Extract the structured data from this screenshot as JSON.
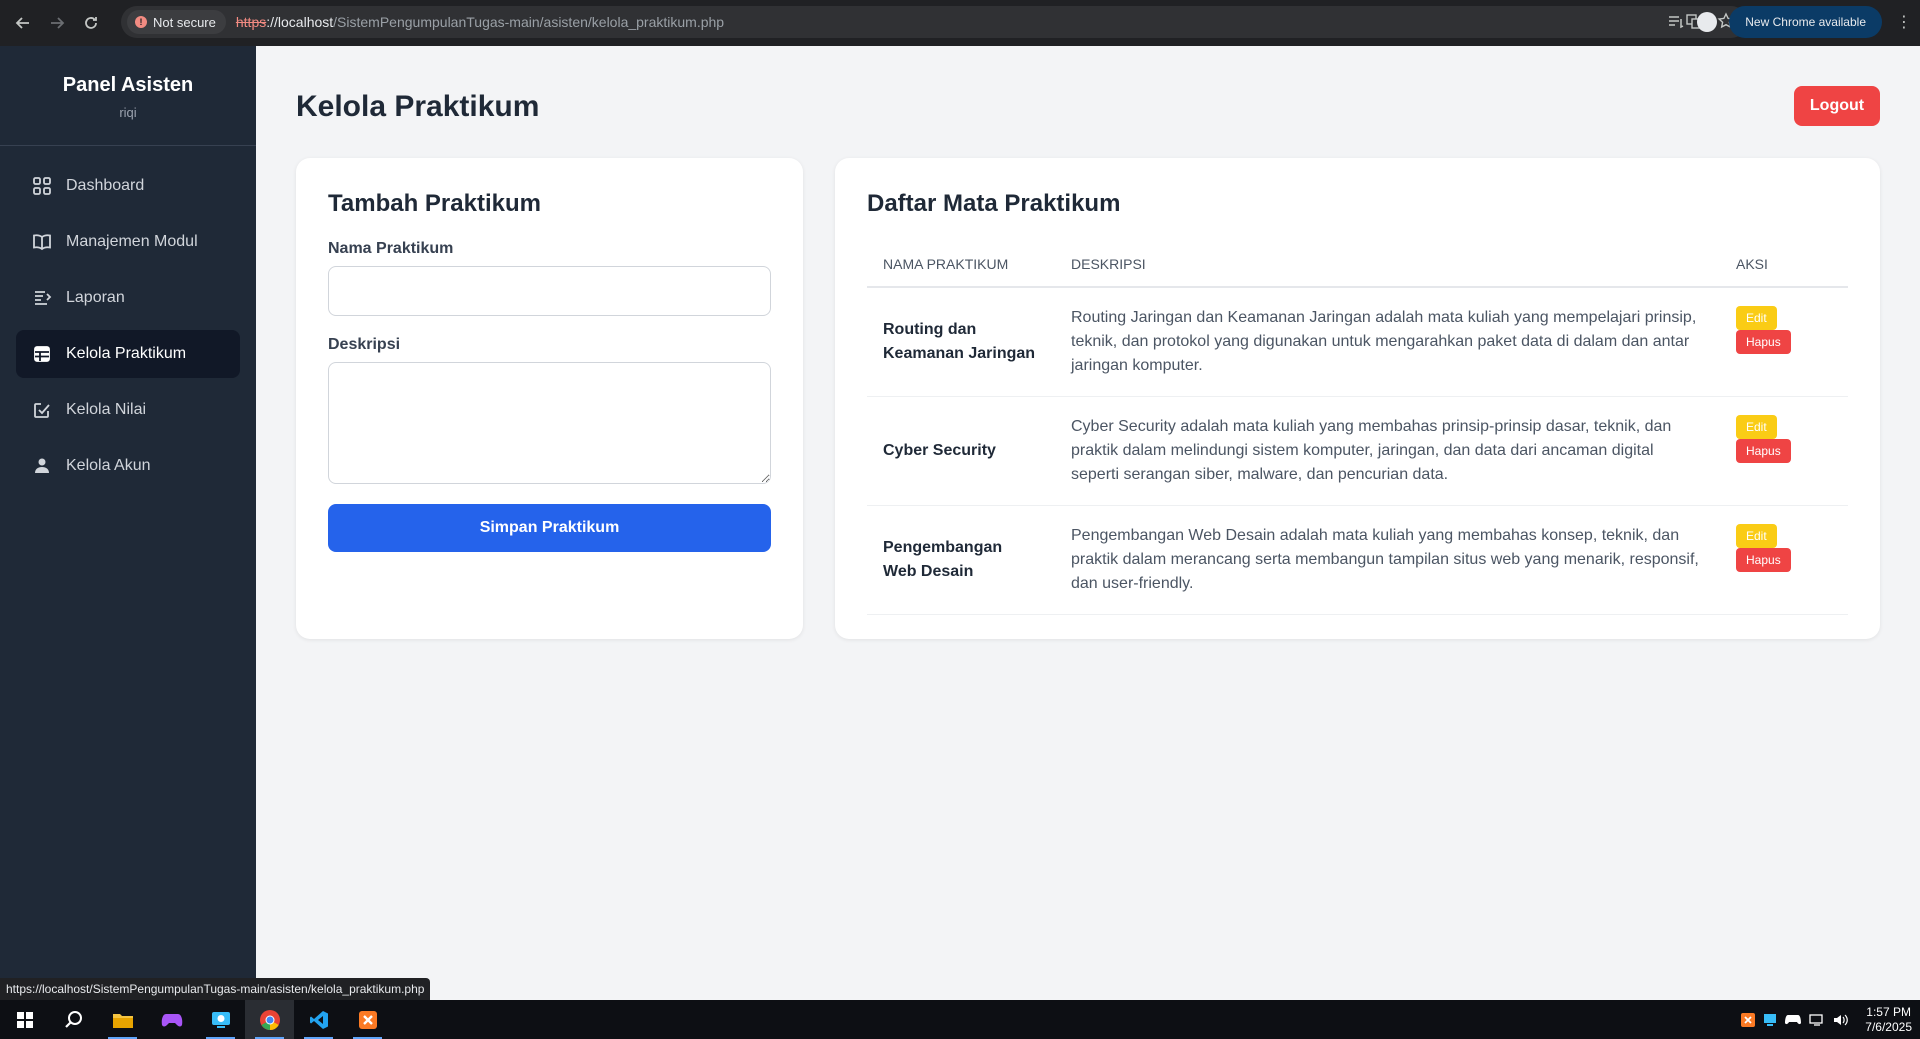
{
  "browser": {
    "security_label": "Not secure",
    "url_scheme": "https",
    "url_host": "://localhost",
    "url_path": "/SistemPengumpulanTugas-main/asisten/kelola_praktikum.php",
    "new_chrome_label": "New Chrome available",
    "status_url": "https://localhost/SistemPengumpulanTugas-main/asisten/kelola_praktikum.php"
  },
  "sidebar": {
    "title": "Panel Asisten",
    "user": "riqi",
    "items": [
      {
        "label": "Dashboard",
        "icon": "grid-icon"
      },
      {
        "label": "Manajemen Modul",
        "icon": "book-icon"
      },
      {
        "label": "Laporan",
        "icon": "list-icon"
      },
      {
        "label": "Kelola Praktikum",
        "icon": "table-icon",
        "active": true
      },
      {
        "label": "Kelola Nilai",
        "icon": "edit-square-icon"
      },
      {
        "label": "Kelola Akun",
        "icon": "user-icon"
      }
    ]
  },
  "header": {
    "title": "Kelola Praktikum",
    "logout_label": "Logout"
  },
  "form": {
    "title": "Tambah Praktikum",
    "name_label": "Nama Praktikum",
    "name_value": "",
    "desc_label": "Deskripsi",
    "desc_value": "",
    "submit_label": "Simpan Praktikum"
  },
  "list": {
    "title": "Daftar Mata Praktikum",
    "columns": [
      "Nama Praktikum",
      "Deskripsi",
      "Aksi"
    ],
    "rows": [
      {
        "name": "Routing dan Keamanan Jaringan",
        "desc": "Routing Jaringan dan Keamanan Jaringan adalah mata kuliah yang mempelajari prinsip, teknik, dan protokol yang digunakan untuk mengarahkan paket data di dalam dan antar jaringan komputer.",
        "edit": "Edit",
        "delete": "Hapus"
      },
      {
        "name": "Cyber Security",
        "desc": "Cyber Security adalah mata kuliah yang membahas prinsip-prinsip dasar, teknik, dan praktik dalam melindungi sistem komputer, jaringan, dan data dari ancaman digital seperti serangan siber, malware, dan pencurian data.",
        "edit": "Edit",
        "delete": "Hapus"
      },
      {
        "name": "Pengembangan Web Desain",
        "desc": "Pengembangan Web Desain adalah mata kuliah yang membahas konsep, teknik, dan praktik dalam merancang serta membangun tampilan situs web yang menarik, responsif, dan user-friendly.",
        "edit": "Edit",
        "delete": "Hapus"
      }
    ]
  },
  "taskbar": {
    "time": "1:57 PM",
    "date": "7/6/2025"
  },
  "colors": {
    "sidebar_bg": "#1f2937",
    "primary": "#2563eb",
    "danger": "#ef4444",
    "warning": "#facc15"
  }
}
